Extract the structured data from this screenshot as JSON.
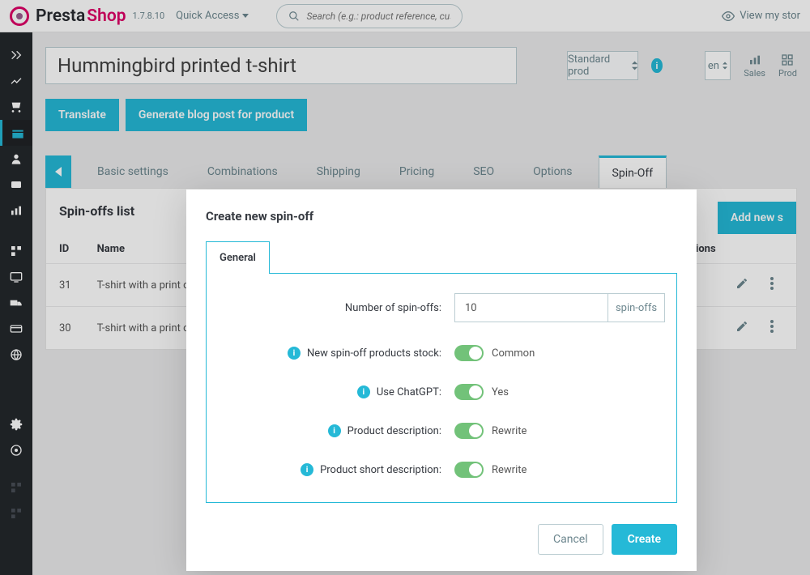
{
  "header": {
    "brand1": "Presta",
    "brand2": "Shop",
    "version": "1.7.8.10",
    "quick_access": "Quick Access",
    "search_placeholder": "Search (e.g.: product reference, custom",
    "view_store": "View my stor"
  },
  "page": {
    "title_value": "Hummingbird printed t-shirt",
    "type_select": "Standard prod",
    "lang": "en",
    "stats": {
      "sales": "Sales",
      "products": "Prod"
    }
  },
  "buttons": {
    "translate": "Translate",
    "generate": "Generate blog post for product",
    "add_new": "Add new s"
  },
  "tabs": [
    "Basic settings",
    "Combinations",
    "Shipping",
    "Pricing",
    "SEO",
    "Options",
    "Spin-Off"
  ],
  "active_tab": 6,
  "list": {
    "heading": "Spin-offs list",
    "columns": {
      "id": "ID",
      "name": "Name",
      "actions": "Actions"
    },
    "rows": [
      {
        "id": "31",
        "name": "T-shirt with a print c"
      },
      {
        "id": "30",
        "name": "T-shirt with a print c"
      }
    ]
  },
  "modal": {
    "title": "Create new spin-off",
    "tab": "General",
    "fields": {
      "number_label": "Number of spin-offs:",
      "number_value": "10",
      "number_suffix": "spin-offs",
      "stock_label": "New spin-off products stock:",
      "stock_value": "Common",
      "chatgpt_label": "Use ChatGPT:",
      "chatgpt_value": "Yes",
      "desc_label": "Product description:",
      "desc_value": "Rewrite",
      "short_label": "Product short description:",
      "short_value": "Rewrite"
    },
    "cancel": "Cancel",
    "create": "Create"
  }
}
